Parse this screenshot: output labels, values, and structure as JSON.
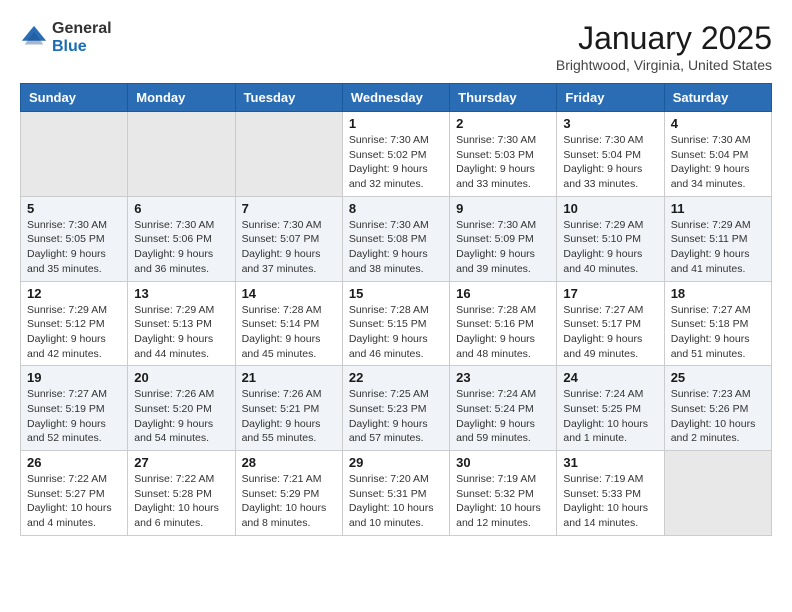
{
  "header": {
    "logo_general": "General",
    "logo_blue": "Blue",
    "month": "January 2025",
    "location": "Brightwood, Virginia, United States"
  },
  "weekdays": [
    "Sunday",
    "Monday",
    "Tuesday",
    "Wednesday",
    "Thursday",
    "Friday",
    "Saturday"
  ],
  "weeks": [
    [
      {
        "day": "",
        "sunrise": "",
        "sunset": "",
        "daylight": ""
      },
      {
        "day": "",
        "sunrise": "",
        "sunset": "",
        "daylight": ""
      },
      {
        "day": "",
        "sunrise": "",
        "sunset": "",
        "daylight": ""
      },
      {
        "day": "1",
        "sunrise": "Sunrise: 7:30 AM",
        "sunset": "Sunset: 5:02 PM",
        "daylight": "Daylight: 9 hours and 32 minutes."
      },
      {
        "day": "2",
        "sunrise": "Sunrise: 7:30 AM",
        "sunset": "Sunset: 5:03 PM",
        "daylight": "Daylight: 9 hours and 33 minutes."
      },
      {
        "day": "3",
        "sunrise": "Sunrise: 7:30 AM",
        "sunset": "Sunset: 5:04 PM",
        "daylight": "Daylight: 9 hours and 33 minutes."
      },
      {
        "day": "4",
        "sunrise": "Sunrise: 7:30 AM",
        "sunset": "Sunset: 5:04 PM",
        "daylight": "Daylight: 9 hours and 34 minutes."
      }
    ],
    [
      {
        "day": "5",
        "sunrise": "Sunrise: 7:30 AM",
        "sunset": "Sunset: 5:05 PM",
        "daylight": "Daylight: 9 hours and 35 minutes."
      },
      {
        "day": "6",
        "sunrise": "Sunrise: 7:30 AM",
        "sunset": "Sunset: 5:06 PM",
        "daylight": "Daylight: 9 hours and 36 minutes."
      },
      {
        "day": "7",
        "sunrise": "Sunrise: 7:30 AM",
        "sunset": "Sunset: 5:07 PM",
        "daylight": "Daylight: 9 hours and 37 minutes."
      },
      {
        "day": "8",
        "sunrise": "Sunrise: 7:30 AM",
        "sunset": "Sunset: 5:08 PM",
        "daylight": "Daylight: 9 hours and 38 minutes."
      },
      {
        "day": "9",
        "sunrise": "Sunrise: 7:30 AM",
        "sunset": "Sunset: 5:09 PM",
        "daylight": "Daylight: 9 hours and 39 minutes."
      },
      {
        "day": "10",
        "sunrise": "Sunrise: 7:29 AM",
        "sunset": "Sunset: 5:10 PM",
        "daylight": "Daylight: 9 hours and 40 minutes."
      },
      {
        "day": "11",
        "sunrise": "Sunrise: 7:29 AM",
        "sunset": "Sunset: 5:11 PM",
        "daylight": "Daylight: 9 hours and 41 minutes."
      }
    ],
    [
      {
        "day": "12",
        "sunrise": "Sunrise: 7:29 AM",
        "sunset": "Sunset: 5:12 PM",
        "daylight": "Daylight: 9 hours and 42 minutes."
      },
      {
        "day": "13",
        "sunrise": "Sunrise: 7:29 AM",
        "sunset": "Sunset: 5:13 PM",
        "daylight": "Daylight: 9 hours and 44 minutes."
      },
      {
        "day": "14",
        "sunrise": "Sunrise: 7:28 AM",
        "sunset": "Sunset: 5:14 PM",
        "daylight": "Daylight: 9 hours and 45 minutes."
      },
      {
        "day": "15",
        "sunrise": "Sunrise: 7:28 AM",
        "sunset": "Sunset: 5:15 PM",
        "daylight": "Daylight: 9 hours and 46 minutes."
      },
      {
        "day": "16",
        "sunrise": "Sunrise: 7:28 AM",
        "sunset": "Sunset: 5:16 PM",
        "daylight": "Daylight: 9 hours and 48 minutes."
      },
      {
        "day": "17",
        "sunrise": "Sunrise: 7:27 AM",
        "sunset": "Sunset: 5:17 PM",
        "daylight": "Daylight: 9 hours and 49 minutes."
      },
      {
        "day": "18",
        "sunrise": "Sunrise: 7:27 AM",
        "sunset": "Sunset: 5:18 PM",
        "daylight": "Daylight: 9 hours and 51 minutes."
      }
    ],
    [
      {
        "day": "19",
        "sunrise": "Sunrise: 7:27 AM",
        "sunset": "Sunset: 5:19 PM",
        "daylight": "Daylight: 9 hours and 52 minutes."
      },
      {
        "day": "20",
        "sunrise": "Sunrise: 7:26 AM",
        "sunset": "Sunset: 5:20 PM",
        "daylight": "Daylight: 9 hours and 54 minutes."
      },
      {
        "day": "21",
        "sunrise": "Sunrise: 7:26 AM",
        "sunset": "Sunset: 5:21 PM",
        "daylight": "Daylight: 9 hours and 55 minutes."
      },
      {
        "day": "22",
        "sunrise": "Sunrise: 7:25 AM",
        "sunset": "Sunset: 5:23 PM",
        "daylight": "Daylight: 9 hours and 57 minutes."
      },
      {
        "day": "23",
        "sunrise": "Sunrise: 7:24 AM",
        "sunset": "Sunset: 5:24 PM",
        "daylight": "Daylight: 9 hours and 59 minutes."
      },
      {
        "day": "24",
        "sunrise": "Sunrise: 7:24 AM",
        "sunset": "Sunset: 5:25 PM",
        "daylight": "Daylight: 10 hours and 1 minute."
      },
      {
        "day": "25",
        "sunrise": "Sunrise: 7:23 AM",
        "sunset": "Sunset: 5:26 PM",
        "daylight": "Daylight: 10 hours and 2 minutes."
      }
    ],
    [
      {
        "day": "26",
        "sunrise": "Sunrise: 7:22 AM",
        "sunset": "Sunset: 5:27 PM",
        "daylight": "Daylight: 10 hours and 4 minutes."
      },
      {
        "day": "27",
        "sunrise": "Sunrise: 7:22 AM",
        "sunset": "Sunset: 5:28 PM",
        "daylight": "Daylight: 10 hours and 6 minutes."
      },
      {
        "day": "28",
        "sunrise": "Sunrise: 7:21 AM",
        "sunset": "Sunset: 5:29 PM",
        "daylight": "Daylight: 10 hours and 8 minutes."
      },
      {
        "day": "29",
        "sunrise": "Sunrise: 7:20 AM",
        "sunset": "Sunset: 5:31 PM",
        "daylight": "Daylight: 10 hours and 10 minutes."
      },
      {
        "day": "30",
        "sunrise": "Sunrise: 7:19 AM",
        "sunset": "Sunset: 5:32 PM",
        "daylight": "Daylight: 10 hours and 12 minutes."
      },
      {
        "day": "31",
        "sunrise": "Sunrise: 7:19 AM",
        "sunset": "Sunset: 5:33 PM",
        "daylight": "Daylight: 10 hours and 14 minutes."
      },
      {
        "day": "",
        "sunrise": "",
        "sunset": "",
        "daylight": ""
      }
    ]
  ]
}
